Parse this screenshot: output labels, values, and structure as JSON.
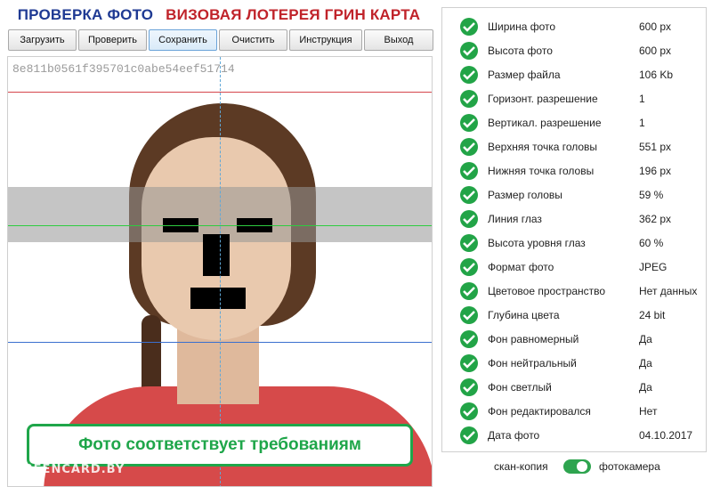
{
  "header": {
    "left_title": "ПРОВЕРКА ФОТО",
    "right_title": "ВИЗОВАЯ ЛОТЕРЕЯ ГРИН КАРТА"
  },
  "toolbar": {
    "buttons": [
      "Загрузить",
      "Проверить",
      "Сохранить",
      "Очистить",
      "Инструкция",
      "Выход"
    ],
    "active": "Сохранить"
  },
  "photo": {
    "hash": "8e811b0561f395701c0abe54eef51714",
    "result": "Фото соответствует требованиям",
    "watermark": "GREENCARD.BY"
  },
  "checks": [
    {
      "label": "Ширина фото",
      "value": "600 px"
    },
    {
      "label": "Высота фото",
      "value": "600 px"
    },
    {
      "label": "Размер файла",
      "value": "106 Kb"
    },
    {
      "label": "Горизонт. разрешение",
      "value": "1"
    },
    {
      "label": "Вертикал. разрешение",
      "value": "1"
    },
    {
      "label": "Верхняя точка головы",
      "value": "551 px"
    },
    {
      "label": "Нижняя точка головы",
      "value": "196 px"
    },
    {
      "label": "Размер головы",
      "value": "59 %"
    },
    {
      "label": "Линия глаз",
      "value": "362 px"
    },
    {
      "label": "Высота уровня глаз",
      "value": "60 %"
    },
    {
      "label": "Формат фото",
      "value": "JPEG"
    },
    {
      "label": "Цветовое пространство",
      "value": "Нет данных"
    },
    {
      "label": "Глубина цвета",
      "value": "24 bit"
    },
    {
      "label": "Фон равномерный",
      "value": "Да"
    },
    {
      "label": "Фон нейтральный",
      "value": "Да"
    },
    {
      "label": "Фон светлый",
      "value": "Да"
    },
    {
      "label": "Фон редактировался",
      "value": "Нет"
    },
    {
      "label": "Дата фото",
      "value": "04.10.2017"
    }
  ],
  "mode": {
    "left_label": "скан-копия",
    "right_label": "фотокамера",
    "selected": "фотокамера"
  },
  "colors": {
    "ok_green": "#22a447",
    "title_blue": "#1f3a93",
    "title_red": "#c0232a",
    "guide_red": "#d5464c",
    "guide_green": "#2ecc40",
    "guide_blue": "#3a6fcf",
    "result_green": "#1fa64a"
  },
  "icons": {
    "check": "check-circle-icon"
  }
}
